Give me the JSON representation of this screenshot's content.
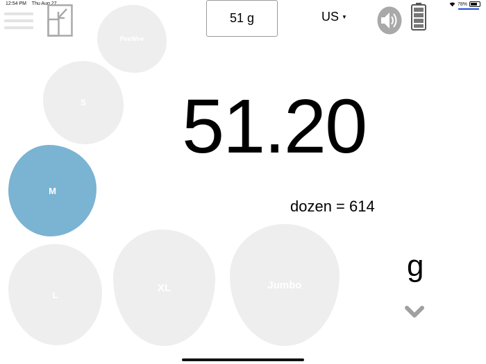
{
  "status_bar": {
    "time": "12:54 PM",
    "date": "Thu Aug 27",
    "wifi_icon": "wifi-icon",
    "battery_percent": "78%"
  },
  "toolbar": {
    "menu_icon": "hamburger-menu-icon",
    "shrink_icon": "shrink-window-icon",
    "weight_display": "51 g",
    "region": "US",
    "speaker_icon": "speaker-icon",
    "battery_icon": "battery-icon"
  },
  "egg_sizes": {
    "peewee": "PeeWee",
    "small": "S",
    "medium": "M",
    "large": "L",
    "xlarge": "XL",
    "jumbo": "Jumbo",
    "selected": "M"
  },
  "reading": {
    "value": "51.20",
    "dozen_text": "dozen = 614",
    "unit": "g"
  },
  "colors": {
    "selected_egg": "#7bb3d2",
    "egg": "#eeeeee",
    "icon_gray": "#a9a9a9",
    "accent_line": "#1e4fd6"
  }
}
